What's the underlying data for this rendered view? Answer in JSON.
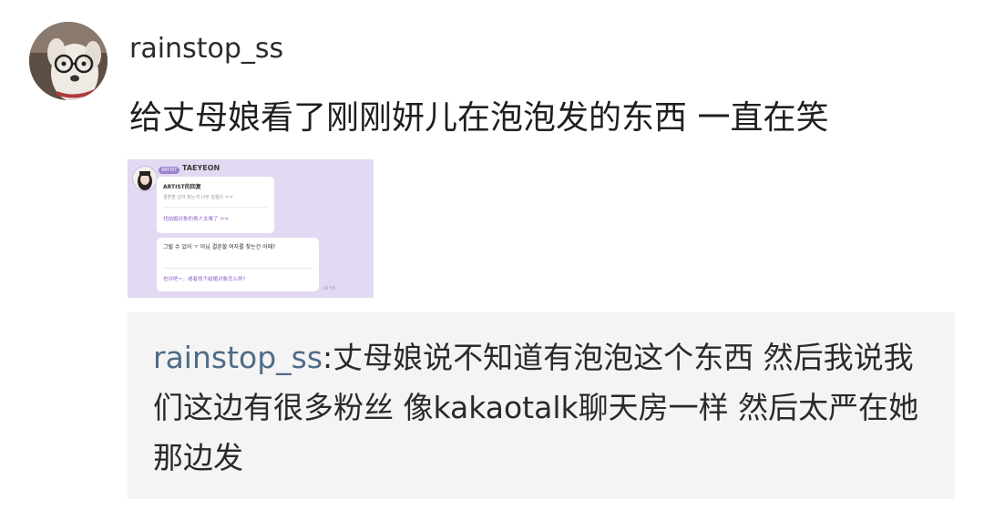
{
  "post": {
    "username": "rainstop_ss",
    "text": "给丈母娘看了刚刚妍儿在泡泡发的东西 一直在笑"
  },
  "attachment": {
    "badge": "ARTIST",
    "name": "TAEYEON",
    "bubble1_title": "ARTIST的回复",
    "bubble1_korean": "결혼할 남자 찾는게 너무 힘들다 ㅠㅠ",
    "bubble1_chinese": "找结婚对象的男人太难了 ㅠㅠ",
    "bubble2_korean": "그럴 수 있어 ㅜ 아님 결혼할 여자를 찾는건 어때?",
    "bubble2_chinese": "也许吧ㅜ，或者找个结婚对象怎么样?",
    "time": "16:55"
  },
  "comment": {
    "username": "rainstop_ss",
    "separator": ":",
    "text": "丈母娘说不知道有泡泡这个东西 然后我说我们这边有很多粉丝 像kakaotalk聊天房一样 然后太严在她那边发"
  },
  "colors": {
    "link_username": "#4f6b87",
    "quote_background": "#f4f4f4",
    "thumbnail_background": "#e3d9f2",
    "accent_purple": "#8a63c8"
  }
}
